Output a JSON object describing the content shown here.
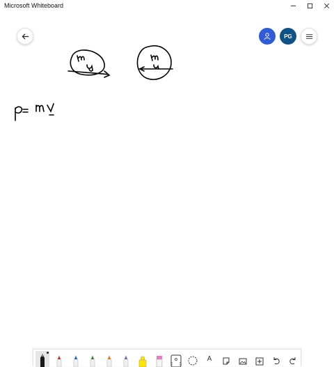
{
  "window": {
    "title": "Microsoft Whiteboard"
  },
  "header": {
    "avatar_initials": "PG"
  },
  "canvas": {
    "ink_1_text": "m",
    "ink_2_text": "m",
    "equation": "p = mv"
  },
  "toolbar": {
    "pen_colors": [
      "#000000",
      "#c62828",
      "#1565c0",
      "#2e7d32",
      "#ef6c00",
      "#6a1b9a"
    ],
    "highlighter_color": "#ffe600",
    "text_tool_glyph": "A",
    "tools": [
      "pen-black",
      "pen-red",
      "pen-blue",
      "pen-green",
      "pen-orange",
      "pen-purple",
      "highlighter",
      "eraser",
      "ruler",
      "lasso",
      "text",
      "sticky-note",
      "image",
      "insert",
      "undo",
      "redo"
    ]
  }
}
